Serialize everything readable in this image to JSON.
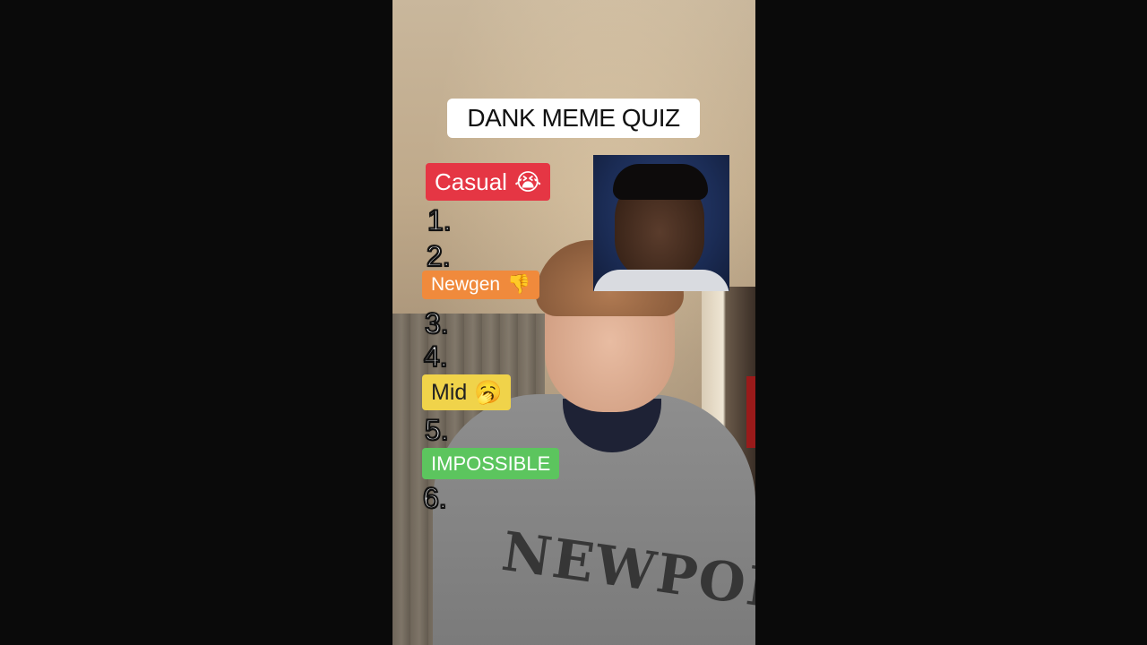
{
  "quiz": {
    "title": "DANK MEME QUIZ",
    "tiers": [
      {
        "label": "Casual",
        "emoji": "😭",
        "color": "#e53644"
      },
      {
        "label": "Newgen",
        "emoji": "👎",
        "color": "#f08a3c"
      },
      {
        "label": "Mid",
        "emoji": "🥱",
        "color": "#f0d34a"
      },
      {
        "label": "IMPOSSIBLE",
        "emoji": "",
        "color": "#5cc55e"
      }
    ],
    "numbers": [
      "1.",
      "2.",
      "3.",
      "4.",
      "5.",
      "6."
    ]
  },
  "video": {
    "shirt_text": "NEWPORT"
  }
}
